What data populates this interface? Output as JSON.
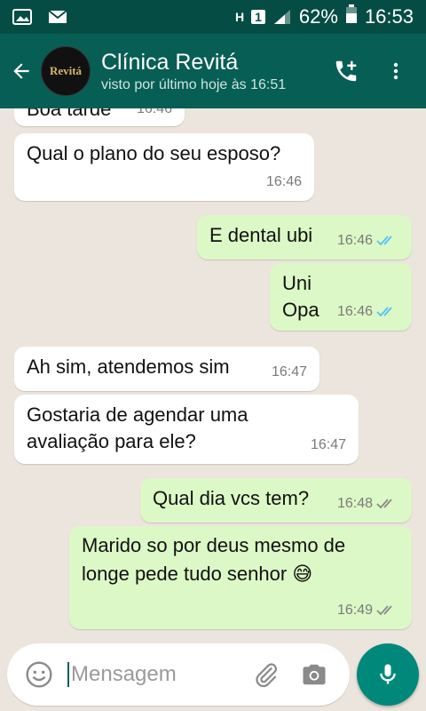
{
  "status_bar": {
    "network": "H",
    "sim": "1",
    "battery": "62%",
    "time": "16:53"
  },
  "header": {
    "avatar_text": "Revitá",
    "contact_name": "Clínica Revitá",
    "last_seen": "visto por último hoje às 16:51"
  },
  "messages": [
    {
      "direction": "in",
      "text": "Boa tarde",
      "time": "16:46"
    },
    {
      "direction": "in",
      "text": "Qual o plano do seu esposo?",
      "time": "16:46"
    },
    {
      "direction": "out",
      "text": "E dental ubi",
      "time": "16:46",
      "status": "read"
    },
    {
      "direction": "out",
      "line1": "Uni",
      "line2": "Opa",
      "time": "16:46",
      "status": "read"
    },
    {
      "direction": "in",
      "text": "Ah sim, atendemos sim",
      "time": "16:47"
    },
    {
      "direction": "in",
      "line1": "Gostaria de agendar uma",
      "line2": "avaliação para ele?",
      "time": "16:47"
    },
    {
      "direction": "out",
      "text": "Qual dia vcs tem?",
      "time": "16:48",
      "status": "delivered"
    },
    {
      "direction": "out",
      "line1": "Marido so por deus mesmo de",
      "line2": "longe pede tudo senhor 😅",
      "time": "16:49",
      "status": "delivered"
    }
  ],
  "composer": {
    "placeholder": "Mensagem"
  },
  "colors": {
    "header": "#075e54",
    "status_bar": "#054d44",
    "incoming_bubble": "#ffffff",
    "outgoing_bubble": "#dcf8c6",
    "read_ticks": "#4fc3f7",
    "mic_button": "#00897b"
  },
  "icons": [
    "gallery-icon",
    "email-icon",
    "signal-icon",
    "battery-icon",
    "back-arrow-icon",
    "add-call-icon",
    "more-vert-icon",
    "emoji-icon",
    "attach-icon",
    "camera-icon",
    "mic-icon"
  ]
}
